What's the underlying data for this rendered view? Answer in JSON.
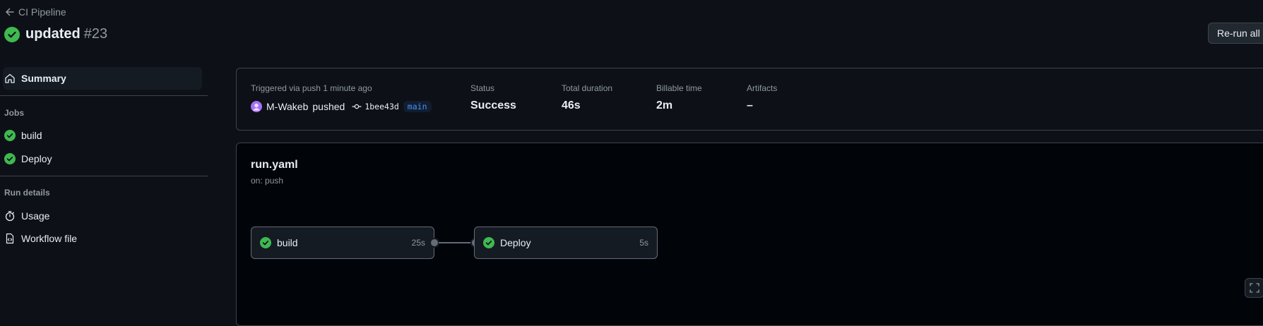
{
  "header": {
    "back_label": "CI Pipeline",
    "title": "updated",
    "run_number": "#23",
    "rerun_label": "Re-run all"
  },
  "sidebar": {
    "summary_label": "Summary",
    "jobs_heading": "Jobs",
    "jobs": [
      {
        "label": "build",
        "status": "success"
      },
      {
        "label": "Deploy",
        "status": "success"
      }
    ],
    "run_details_heading": "Run details",
    "details": [
      {
        "label": "Usage",
        "icon": "stopwatch-icon"
      },
      {
        "label": "Workflow file",
        "icon": "file-code-icon"
      }
    ]
  },
  "summary": {
    "trigger_label": "Triggered via push 1 minute ago",
    "actor": "M-Wakeb",
    "action": "pushed",
    "commit_sha": "1bee43d",
    "branch": "main",
    "status_label": "Status",
    "status_value": "Success",
    "duration_label": "Total duration",
    "duration_value": "46s",
    "billable_label": "Billable time",
    "billable_value": "2m",
    "artifacts_label": "Artifacts",
    "artifacts_value": "–"
  },
  "workflow": {
    "name": "run.yaml",
    "trigger": "on: push",
    "jobs": [
      {
        "name": "build",
        "duration": "25s",
        "status": "success"
      },
      {
        "name": "Deploy",
        "duration": "5s",
        "status": "success"
      }
    ]
  },
  "colors": {
    "background": "#0d1117",
    "success": "#3fb950",
    "border": "#3d444d",
    "muted": "#9198a1",
    "link": "#4493f8"
  }
}
